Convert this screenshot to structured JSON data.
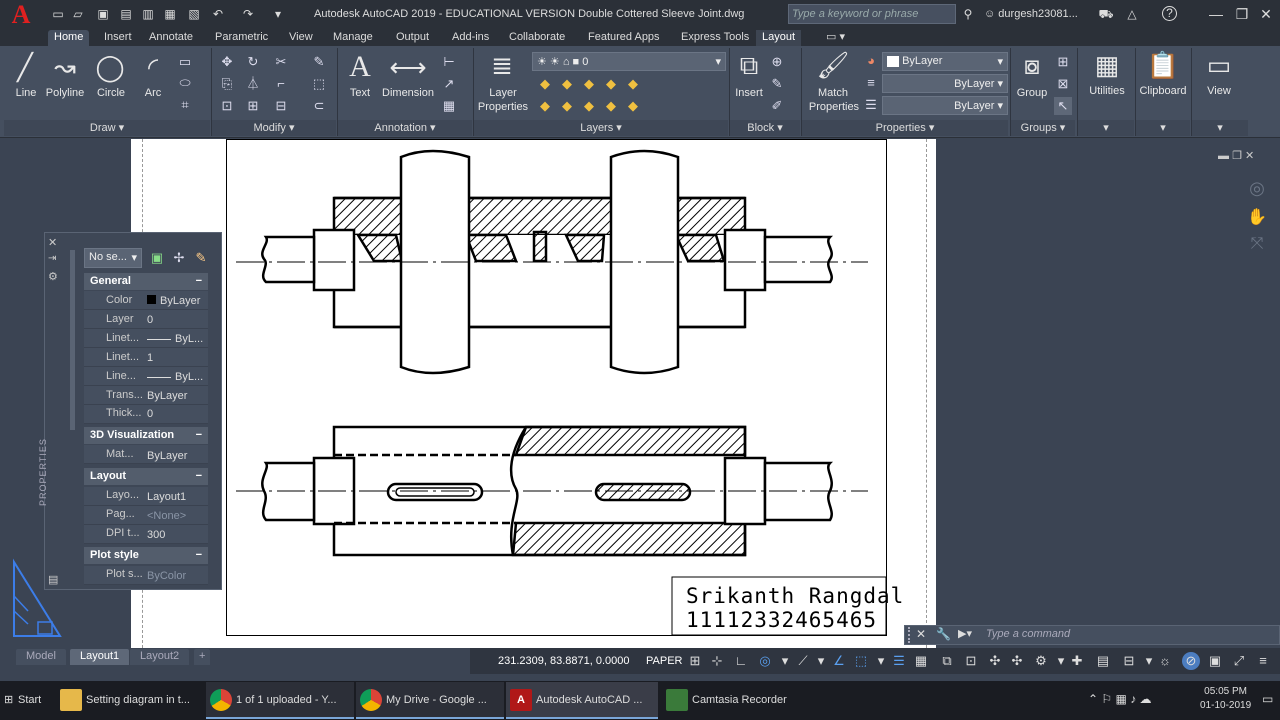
{
  "app": {
    "logo": "A",
    "title": "Autodesk AutoCAD 2019 - EDUCATIONAL VERSION    Double Cottered Sleeve Joint.dwg",
    "search_placeholder": "Type a keyword or phrase",
    "user": "durgesh23081...",
    "help": "?"
  },
  "tabs": [
    "Home",
    "Insert",
    "Annotate",
    "Parametric",
    "View",
    "Manage",
    "Output",
    "Add-ins",
    "Collaborate",
    "Featured Apps",
    "Express Tools",
    "Layout"
  ],
  "ribbon": {
    "draw": {
      "line": "Line",
      "polyline": "Polyline",
      "circle": "Circle",
      "arc": "Arc",
      "title": "Draw ▾"
    },
    "modify": {
      "title": "Modify ▾"
    },
    "annotation": {
      "text": "Text",
      "dimension": "Dimension",
      "title": "Annotation ▾"
    },
    "layers": {
      "layer_props_1": "Layer",
      "layer_props_2": "Properties",
      "current_layer": "0",
      "title": "Layers ▾"
    },
    "block": {
      "insert": "Insert",
      "title": "Block ▾"
    },
    "properties": {
      "match_1": "Match",
      "match_2": "Properties",
      "color": "ByLayer",
      "linetype": "ByLayer",
      "lineweight": "ByLayer",
      "title": "Properties ▾"
    },
    "groups": {
      "group": "Group",
      "title": "Groups ▾"
    },
    "utilities": "Utilities",
    "clipboard": "Clipboard",
    "view": "View"
  },
  "properties_palette": {
    "selection": "No se...",
    "side_label": "PROPERTIES",
    "sections": [
      {
        "title": "General",
        "toggle": "−",
        "rows": [
          {
            "label": "Color",
            "value": "ByLayer"
          },
          {
            "label": "Layer",
            "value": "0"
          },
          {
            "label": "Linet...",
            "value": "ByL..."
          },
          {
            "label": "Linet...",
            "value": "1"
          },
          {
            "label": "Line...",
            "value": "ByL..."
          },
          {
            "label": "Trans...",
            "value": "ByLayer"
          },
          {
            "label": "Thick...",
            "value": "0"
          }
        ]
      },
      {
        "title": "3D Visualization",
        "toggle": "−",
        "rows": [
          {
            "label": "Mat...",
            "value": "ByLayer"
          }
        ]
      },
      {
        "title": "Layout",
        "toggle": "−",
        "rows": [
          {
            "label": "Layo...",
            "value": "Layout1"
          },
          {
            "label": "Pag...",
            "value": "<None>"
          },
          {
            "label": "DPI t...",
            "value": "300"
          }
        ]
      },
      {
        "title": "Plot style",
        "toggle": "−",
        "rows": [
          {
            "label": "Plot s...",
            "value": "ByColor"
          }
        ]
      }
    ]
  },
  "drawing": {
    "author": "Srikanth  Rangdal",
    "id": "11112332465465"
  },
  "layout_tabs": [
    "Model",
    "Layout1",
    "Layout2",
    "+"
  ],
  "status": {
    "coords": "231.2309, 83.8871, 0.0000",
    "space": "PAPER"
  },
  "command": {
    "placeholder": "Type a command"
  },
  "taskbar": {
    "start": "Start",
    "items": [
      "Setting diagram in t...",
      "1 of 1 uploaded - Y...",
      "My Drive - Google ...",
      "Autodesk AutoCAD ...",
      "Camtasia Recorder"
    ],
    "time": "05:05 PM",
    "date": "01-10-2019"
  },
  "colors": {
    "accent": "#e02020",
    "ribbon": "#454f5f",
    "titlebar": "#2b3038"
  }
}
